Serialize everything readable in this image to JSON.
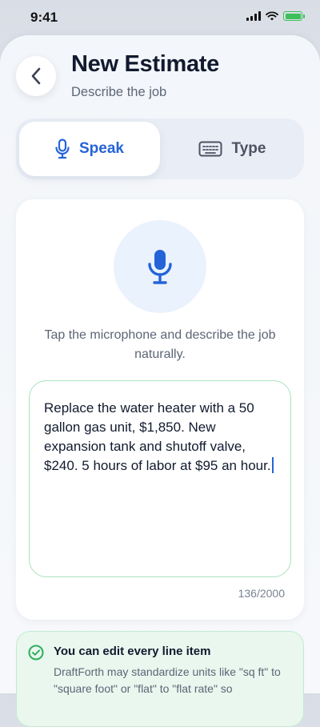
{
  "status_bar": {
    "time": "9:41",
    "battery_color": "#3cc05a"
  },
  "header": {
    "back_icon": "chevron-left-icon",
    "title": "New Estimate",
    "subtitle": "Describe the job"
  },
  "input_mode": {
    "selected": "Speak",
    "tabs": [
      {
        "label": "Speak",
        "icon": "microphone-icon",
        "active": true
      },
      {
        "label": "Type",
        "icon": "keyboard-icon",
        "active": false
      }
    ]
  },
  "recorder": {
    "mic_icon": "microphone-icon",
    "hint": "Tap the microphone and describe the job naturally."
  },
  "job_description": {
    "value": "Replace the water heater with a 50 gallon gas unit, $1,850. New expansion tank and shutoff valve, $240. 5 hours of labor at $95 an hour.",
    "char_count": "136/2000"
  },
  "notice": {
    "icon": "check-circle-icon",
    "title": "You can edit every line item",
    "body": "DraftForth may standardize units like \"sq ft\" to \"square foot\" or \"flat\" to \"flat rate\" so"
  },
  "colors": {
    "accent": "#2563d9",
    "success": "#2fae5b",
    "notice_bg": "#e9f7ee"
  }
}
